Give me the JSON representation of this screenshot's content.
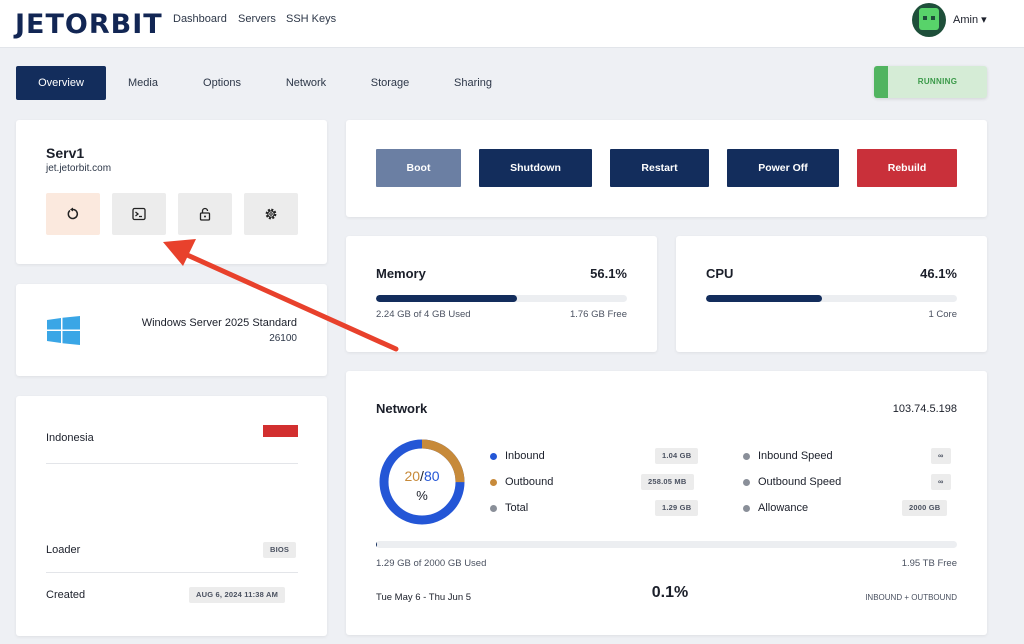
{
  "brand": {
    "logo_text": "JETORBIT"
  },
  "nav": {
    "links": [
      "Dashboard",
      "Servers",
      "SSH Keys"
    ],
    "user": "Amin ▾"
  },
  "tabs": [
    "Overview",
    "Media",
    "Options",
    "Network",
    "Storage",
    "Sharing"
  ],
  "status": {
    "label": "RUNNING",
    "color": "#51b460"
  },
  "server": {
    "name": "Serv1",
    "hostname": "jet.jetorbit.com",
    "quick_actions": [
      "reset-icon",
      "console-icon",
      "lock-icon",
      "settings-icon"
    ]
  },
  "os": {
    "name": "Windows Server 2025 Standard",
    "build": "26100",
    "icon": "windows-icon"
  },
  "info": {
    "location": "Indonesia",
    "loader_label": "Loader",
    "loader_value": "BIOS",
    "created_label": "Created",
    "created_value": "AUG 6, 2024 11:38 AM"
  },
  "actions": {
    "boot": "Boot",
    "shutdown": "Shutdown",
    "restart": "Restart",
    "power_off": "Power Off",
    "rebuild": "Rebuild"
  },
  "memory": {
    "title": "Memory",
    "percent": "56.1%",
    "fraction": 0.561,
    "used": "2.24 GB of 4 GB Used",
    "free": "1.76 GB Free"
  },
  "cpu": {
    "title": "CPU",
    "percent": "46.1%",
    "fraction": 0.461,
    "cores": "1 Core"
  },
  "network": {
    "title": "Network",
    "ip": "103.74.5.198",
    "donut": {
      "value": "20",
      "separator": "/",
      "total": "80",
      "unit": "%",
      "fraction": 0.25
    },
    "inbound_label": "Inbound",
    "inbound_value": "1.04 GB",
    "outbound_label": "Outbound",
    "outbound_value": "258.05 MB",
    "total_label": "Total",
    "total_value": "1.29 GB",
    "inbound_speed_label": "Inbound Speed",
    "inbound_speed_value": "∞",
    "outbound_speed_label": "Outbound Speed",
    "outbound_speed_value": "∞",
    "allowance_label": "Allowance",
    "allowance_value": "2000 GB",
    "usage_fraction": 0.001,
    "used_text": "1.29 GB of 2000 GB Used",
    "free_text": "1.95 TB Free",
    "period": "Tue May 6 - Thu Jun 5",
    "period_percent": "0.1%",
    "scope": "INBOUND + OUTBOUND"
  },
  "colors": {
    "primary": "#132d5c",
    "boot": "#6b7fa3",
    "rebuild": "#c9303a",
    "inbound": "#2456d6",
    "outbound": "#c78a3a",
    "neutral": "#8a8f99"
  }
}
